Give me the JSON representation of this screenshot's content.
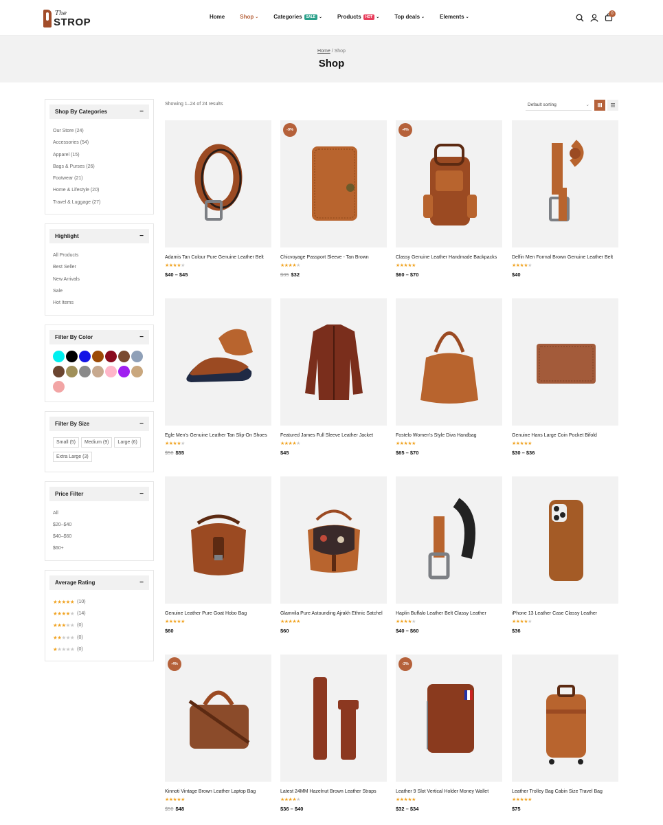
{
  "header": {
    "logo_the": "The",
    "logo_name": "STROP",
    "nav": [
      {
        "label": "Home",
        "caret": false,
        "badge": ""
      },
      {
        "label": "Shop",
        "caret": true,
        "badge": ""
      },
      {
        "label": "Categories",
        "caret": true,
        "badge": "SALE"
      },
      {
        "label": "Products",
        "caret": true,
        "badge": "HOT"
      },
      {
        "label": "Top deals",
        "caret": true,
        "badge": ""
      },
      {
        "label": "Elements",
        "caret": true,
        "badge": ""
      }
    ],
    "active_nav": "Shop",
    "cart_count": "0",
    "icons": [
      "search-icon",
      "user-icon",
      "cart-icon"
    ]
  },
  "page": {
    "breadcrumb_home": "Home",
    "breadcrumb_sep": "/",
    "breadcrumb_current": "Shop",
    "title": "Shop"
  },
  "sidebar": {
    "categories": {
      "title": "Shop By Categories",
      "toggle": "−",
      "items": [
        "Our Store (24)",
        "Accessories (54)",
        "Apparel (15)",
        "Bags & Purses (26)",
        "Footwear (21)",
        "Home & Lifestyle (20)",
        "Travel & Luggage (27)"
      ]
    },
    "highlight": {
      "title": "Highlight",
      "toggle": "−",
      "items": [
        "All Products",
        "Best Seller",
        "New Arrivals",
        "Sale",
        "Hot Items"
      ]
    },
    "color": {
      "title": "Filter By Color",
      "toggle": "−",
      "swatches": [
        "#00f0f0",
        "#000000",
        "#1414e6",
        "#9c4a06",
        "#8a0b1e",
        "#7a4a30",
        "#8fa0b8",
        "#6a4530",
        "#a0905a",
        "#8a8a8a",
        "#c7a98f",
        "#ffb6c9",
        "#a020f0",
        "#c9a77e",
        "#f2a5a5"
      ]
    },
    "size": {
      "title": "Filter By Size",
      "toggle": "−",
      "items": [
        "Small (5)",
        "Medium (9)",
        "Large (6)",
        "Extra Large (3)"
      ]
    },
    "price": {
      "title": "Price Filter",
      "toggle": "−",
      "items": [
        "All",
        "$20–$40",
        "$40–$60",
        "$60+"
      ]
    },
    "rating": {
      "title": "Average Rating",
      "toggle": "−",
      "items": [
        {
          "stars": 5,
          "count": "(10)"
        },
        {
          "stars": 4,
          "count": "(14)"
        },
        {
          "stars": 3,
          "count": "(0)"
        },
        {
          "stars": 2,
          "count": "(0)"
        },
        {
          "stars": 1,
          "count": "(0)"
        }
      ]
    }
  },
  "toolbar": {
    "result_count": "Showing 1–24 of 24 results",
    "sorting": "Default sorting"
  },
  "products": [
    {
      "name": "Adamis Tan Colour Pure Genuine Leather Belt",
      "stars": 4,
      "price": "$40 – $45",
      "old_price": "",
      "badge": "",
      "art": "belt"
    },
    {
      "name": "Chicvoyage Passport Sleeve - Tan Brown",
      "stars": 4,
      "price": "$32",
      "old_price": "$35",
      "badge": "-9%",
      "art": "passport"
    },
    {
      "name": "Classy Genuine Leather Handmade Backpacks",
      "stars": 5,
      "price": "$60 – $70",
      "old_price": "",
      "badge": "-4%",
      "art": "backpack"
    },
    {
      "name": "Delfin Men Formal Brown Genuine Leather Belt",
      "stars": 4,
      "price": "$40",
      "old_price": "",
      "badge": "",
      "art": "belt2"
    },
    {
      "name": "Egle Men's Genuine Leather Tan Slip-On Shoes",
      "stars": 4,
      "price": "$55",
      "old_price": "$58",
      "badge": "",
      "art": "shoes"
    },
    {
      "name": "Featured James Full Sleeve Leather Jacket",
      "stars": 4,
      "price": "$45",
      "old_price": "",
      "badge": "",
      "art": "jacket"
    },
    {
      "name": "Fostelo Women's Style Diva Handbag",
      "stars": 5,
      "price": "$65 – $70",
      "old_price": "",
      "badge": "",
      "art": "handbag"
    },
    {
      "name": "Genuine Hans Large Coin Pocket Bifold",
      "stars": 5,
      "price": "$30 – $36",
      "old_price": "",
      "badge": "",
      "art": "wallet"
    },
    {
      "name": "Genuine Leather Pure Goat Hobo Bag",
      "stars": 5,
      "price": "$60",
      "old_price": "",
      "badge": "",
      "art": "hobo"
    },
    {
      "name": "Glamvila Pure Astounding Ajrakh Ethnic Satchel",
      "stars": 5,
      "price": "$60",
      "old_price": "",
      "badge": "",
      "art": "satchel"
    },
    {
      "name": "Haplin Buffalo Leather Belt Classy Leather",
      "stars": 4,
      "price": "$40 – $60",
      "old_price": "",
      "badge": "",
      "art": "belt3"
    },
    {
      "name": "iPhone 13 Leather Case Classy Leather",
      "stars": 4,
      "price": "$36",
      "old_price": "",
      "badge": "",
      "art": "phone"
    },
    {
      "name": "Kinnoti Vintage Brown Leather Laptop Bag",
      "stars": 5,
      "price": "$48",
      "old_price": "$50",
      "badge": "-4%",
      "art": "laptopbag"
    },
    {
      "name": "Latest 24MM Hazelnut Brown Leather Straps",
      "stars": 4,
      "price": "$36 – $40",
      "old_price": "",
      "badge": "",
      "art": "straps"
    },
    {
      "name": "Leather 9 Slot Vertical Holder Money Wallet",
      "stars": 5,
      "price": "$32 – $34",
      "old_price": "",
      "badge": "-3%",
      "art": "cardholder"
    },
    {
      "name": "Leather Trolley Bag Cabin Size Travel Bag",
      "stars": 5,
      "price": "$75",
      "old_price": "",
      "badge": "",
      "art": "trolley"
    }
  ],
  "colors": {
    "accent": "#b5613a",
    "star": "#f0a21f",
    "band": "#f2f2f2"
  }
}
